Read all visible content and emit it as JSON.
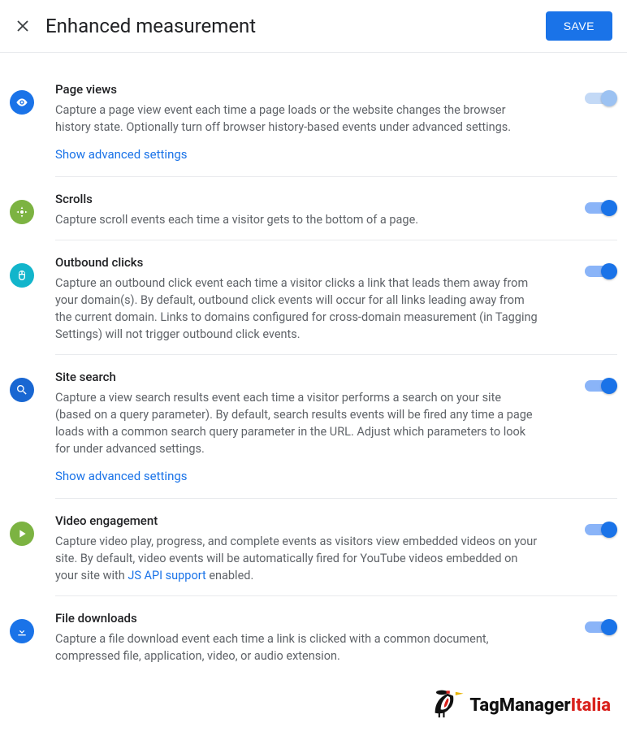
{
  "header": {
    "title": "Enhanced measurement",
    "save_label": "SAVE"
  },
  "settings": [
    {
      "id": "page-views",
      "icon": "eye",
      "icon_color": "blue",
      "title": "Page views",
      "description": "Capture a page view event each time a page loads or the website changes the browser history state. Optionally turn off browser history-based events under advanced settings.",
      "advanced_link_label": "Show advanced settings",
      "toggle_on": true,
      "toggle_locked": true
    },
    {
      "id": "scrolls",
      "icon": "compass",
      "icon_color": "green",
      "title": "Scrolls",
      "description": "Capture scroll events each time a visitor gets to the bottom of a page.",
      "toggle_on": true,
      "toggle_locked": false
    },
    {
      "id": "outbound-clicks",
      "icon": "mouse",
      "icon_color": "cyan",
      "title": "Outbound clicks",
      "description": "Capture an outbound click event each time a visitor clicks a link that leads them away from your domain(s). By default, outbound click events will occur for all links leading away from the current domain. Links to domains configured for cross-domain measurement (in Tagging Settings) will not trigger outbound click events.",
      "toggle_on": true,
      "toggle_locked": false
    },
    {
      "id": "site-search",
      "icon": "search",
      "icon_color": "darkblue",
      "title": "Site search",
      "description": "Capture a view search results event each time a visitor performs a search on your site (based on a query parameter). By default, search results events will be fired any time a page loads with a common search query parameter in the URL. Adjust which parameters to look for under advanced settings.",
      "advanced_link_label": "Show advanced settings",
      "toggle_on": true,
      "toggle_locked": false
    },
    {
      "id": "video-engagement",
      "icon": "play",
      "icon_color": "green",
      "title": "Video engagement",
      "description_pre": "Capture video play, progress, and complete events as visitors view embedded videos on your site. By default, video events will be automatically fired for YouTube videos embedded on your site with ",
      "description_link": "JS API support",
      "description_post": " enabled.",
      "toggle_on": true,
      "toggle_locked": false
    },
    {
      "id": "file-downloads",
      "icon": "download",
      "icon_color": "blue",
      "title": "File downloads",
      "description": "Capture a file download event each time a link is clicked with a common document, compressed file, application, video, or audio extension.",
      "toggle_on": true,
      "toggle_locked": false
    }
  ],
  "footer": {
    "logo_text_1": "TagManager",
    "logo_text_2": "Italia"
  }
}
